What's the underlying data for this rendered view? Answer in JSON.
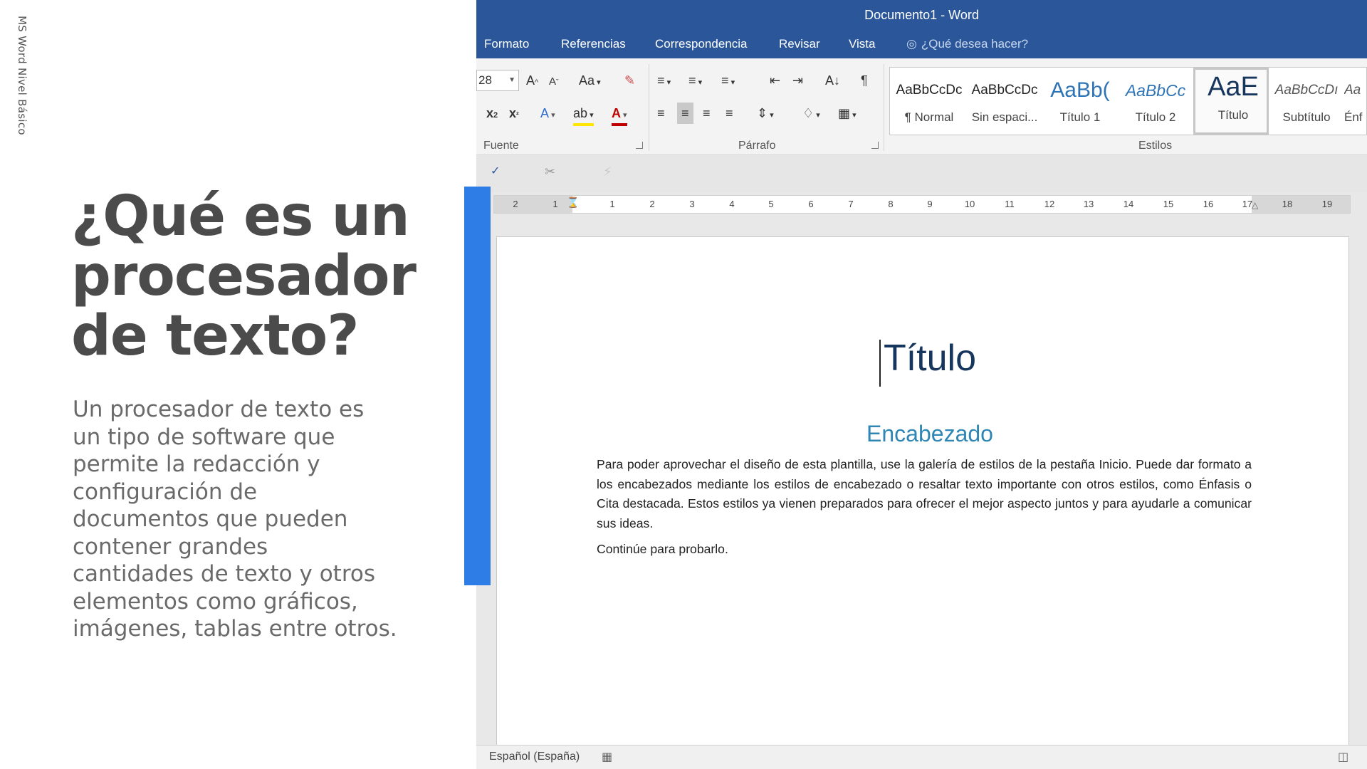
{
  "slide": {
    "caption": "MS Word Nivel Básico",
    "heading_lines": [
      "¿Qué es un",
      "procesador",
      "de texto?"
    ],
    "body_lines": [
      "Un procesador de texto es",
      "un tipo de software que",
      "permite la redacción y",
      "configuración de",
      "documentos que pueden",
      "contener grandes",
      "cantidades de texto y otros",
      "elementos como gráficos,",
      "imágenes, tablas entre otros."
    ],
    "accent_color": "#2e7ce6"
  },
  "word": {
    "window_title": "Documento1 - Word",
    "brand_color": "#2b579a",
    "tabs": [
      "Formato",
      "Referencias",
      "Correspondencia",
      "Revisar",
      "Vista"
    ],
    "tell_me": "¿Qué desea hacer?",
    "font_size": "28",
    "groups": {
      "font": "Fuente",
      "paragraph": "Párrafo",
      "styles": "Estilos"
    },
    "styles": [
      {
        "preview": "AaBbCcDc",
        "name": "¶ Normal"
      },
      {
        "preview": "AaBbCcDc",
        "name": "Sin espaci..."
      },
      {
        "preview": "AaBb(",
        "name": "Título 1"
      },
      {
        "preview": "AaBbCc",
        "name": "Título 2"
      },
      {
        "preview": "AaE",
        "name": "Título"
      },
      {
        "preview": "AaBbCcDı",
        "name": "Subtítulo"
      },
      {
        "preview": "Aa",
        "name": "Énf"
      }
    ],
    "ruler_numbers": [
      "2",
      "1",
      "1",
      "2",
      "3",
      "4",
      "5",
      "6",
      "7",
      "8",
      "9",
      "10",
      "11",
      "12",
      "13",
      "14",
      "15",
      "16",
      "17",
      "18",
      "19"
    ],
    "document": {
      "title": "Título",
      "heading": "Encabezado",
      "paragraph": "Para poder aprovechar el diseño de esta plantilla, use la galería de estilos de la pestaña Inicio. Puede dar formato a los encabezados mediante los estilos de encabezado o resaltar texto importante con otros estilos, como Énfasis o Cita destacada. Estos estilos ya vienen preparados para ofrecer el mejor aspecto juntos y para ayudarle a comunicar sus ideas.",
      "paragraph2": "Continúe para probarlo."
    },
    "status_language": "Español (España)",
    "icons": [
      "font-grow-icon",
      "font-shrink-icon",
      "change-case-icon",
      "clear-format-icon",
      "subscript-icon",
      "superscript-icon",
      "text-effects-icon",
      "highlight-icon",
      "font-color-icon",
      "bullets-icon",
      "numbering-icon",
      "multilevel-icon",
      "decrease-indent-icon",
      "increase-indent-icon",
      "sort-icon",
      "pilcrow-icon",
      "align-left-icon",
      "align-center-icon",
      "align-right-icon",
      "justify-icon",
      "line-spacing-icon",
      "shading-icon",
      "borders-icon",
      "spelling-icon",
      "cut-icon",
      "lightbulb-icon",
      "macro-icon",
      "read-mode-icon"
    ]
  }
}
